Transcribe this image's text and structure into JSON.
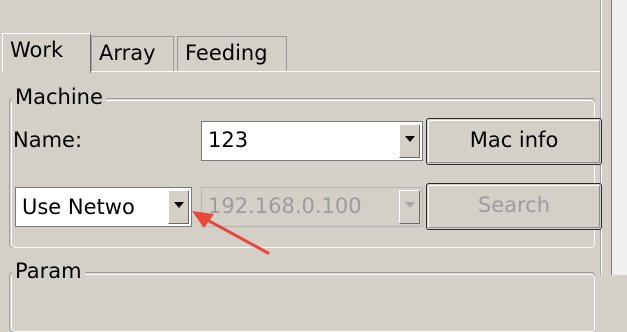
{
  "tabs": [
    {
      "label": "Work",
      "active": true
    },
    {
      "label": "Array",
      "active": false
    },
    {
      "label": "Feeding",
      "active": false
    }
  ],
  "machine": {
    "legend": "Machine",
    "name_label": "Name:",
    "name_value": "123",
    "mac_info_button": "Mac info",
    "connection_value": "Use Netwo",
    "ip_value": "192.168.0.100",
    "search_button": "Search"
  },
  "param": {
    "legend": "Param"
  },
  "annotation": {
    "arrow_color": "#e8463b"
  },
  "colors": {
    "face": "#d4d0c8"
  }
}
